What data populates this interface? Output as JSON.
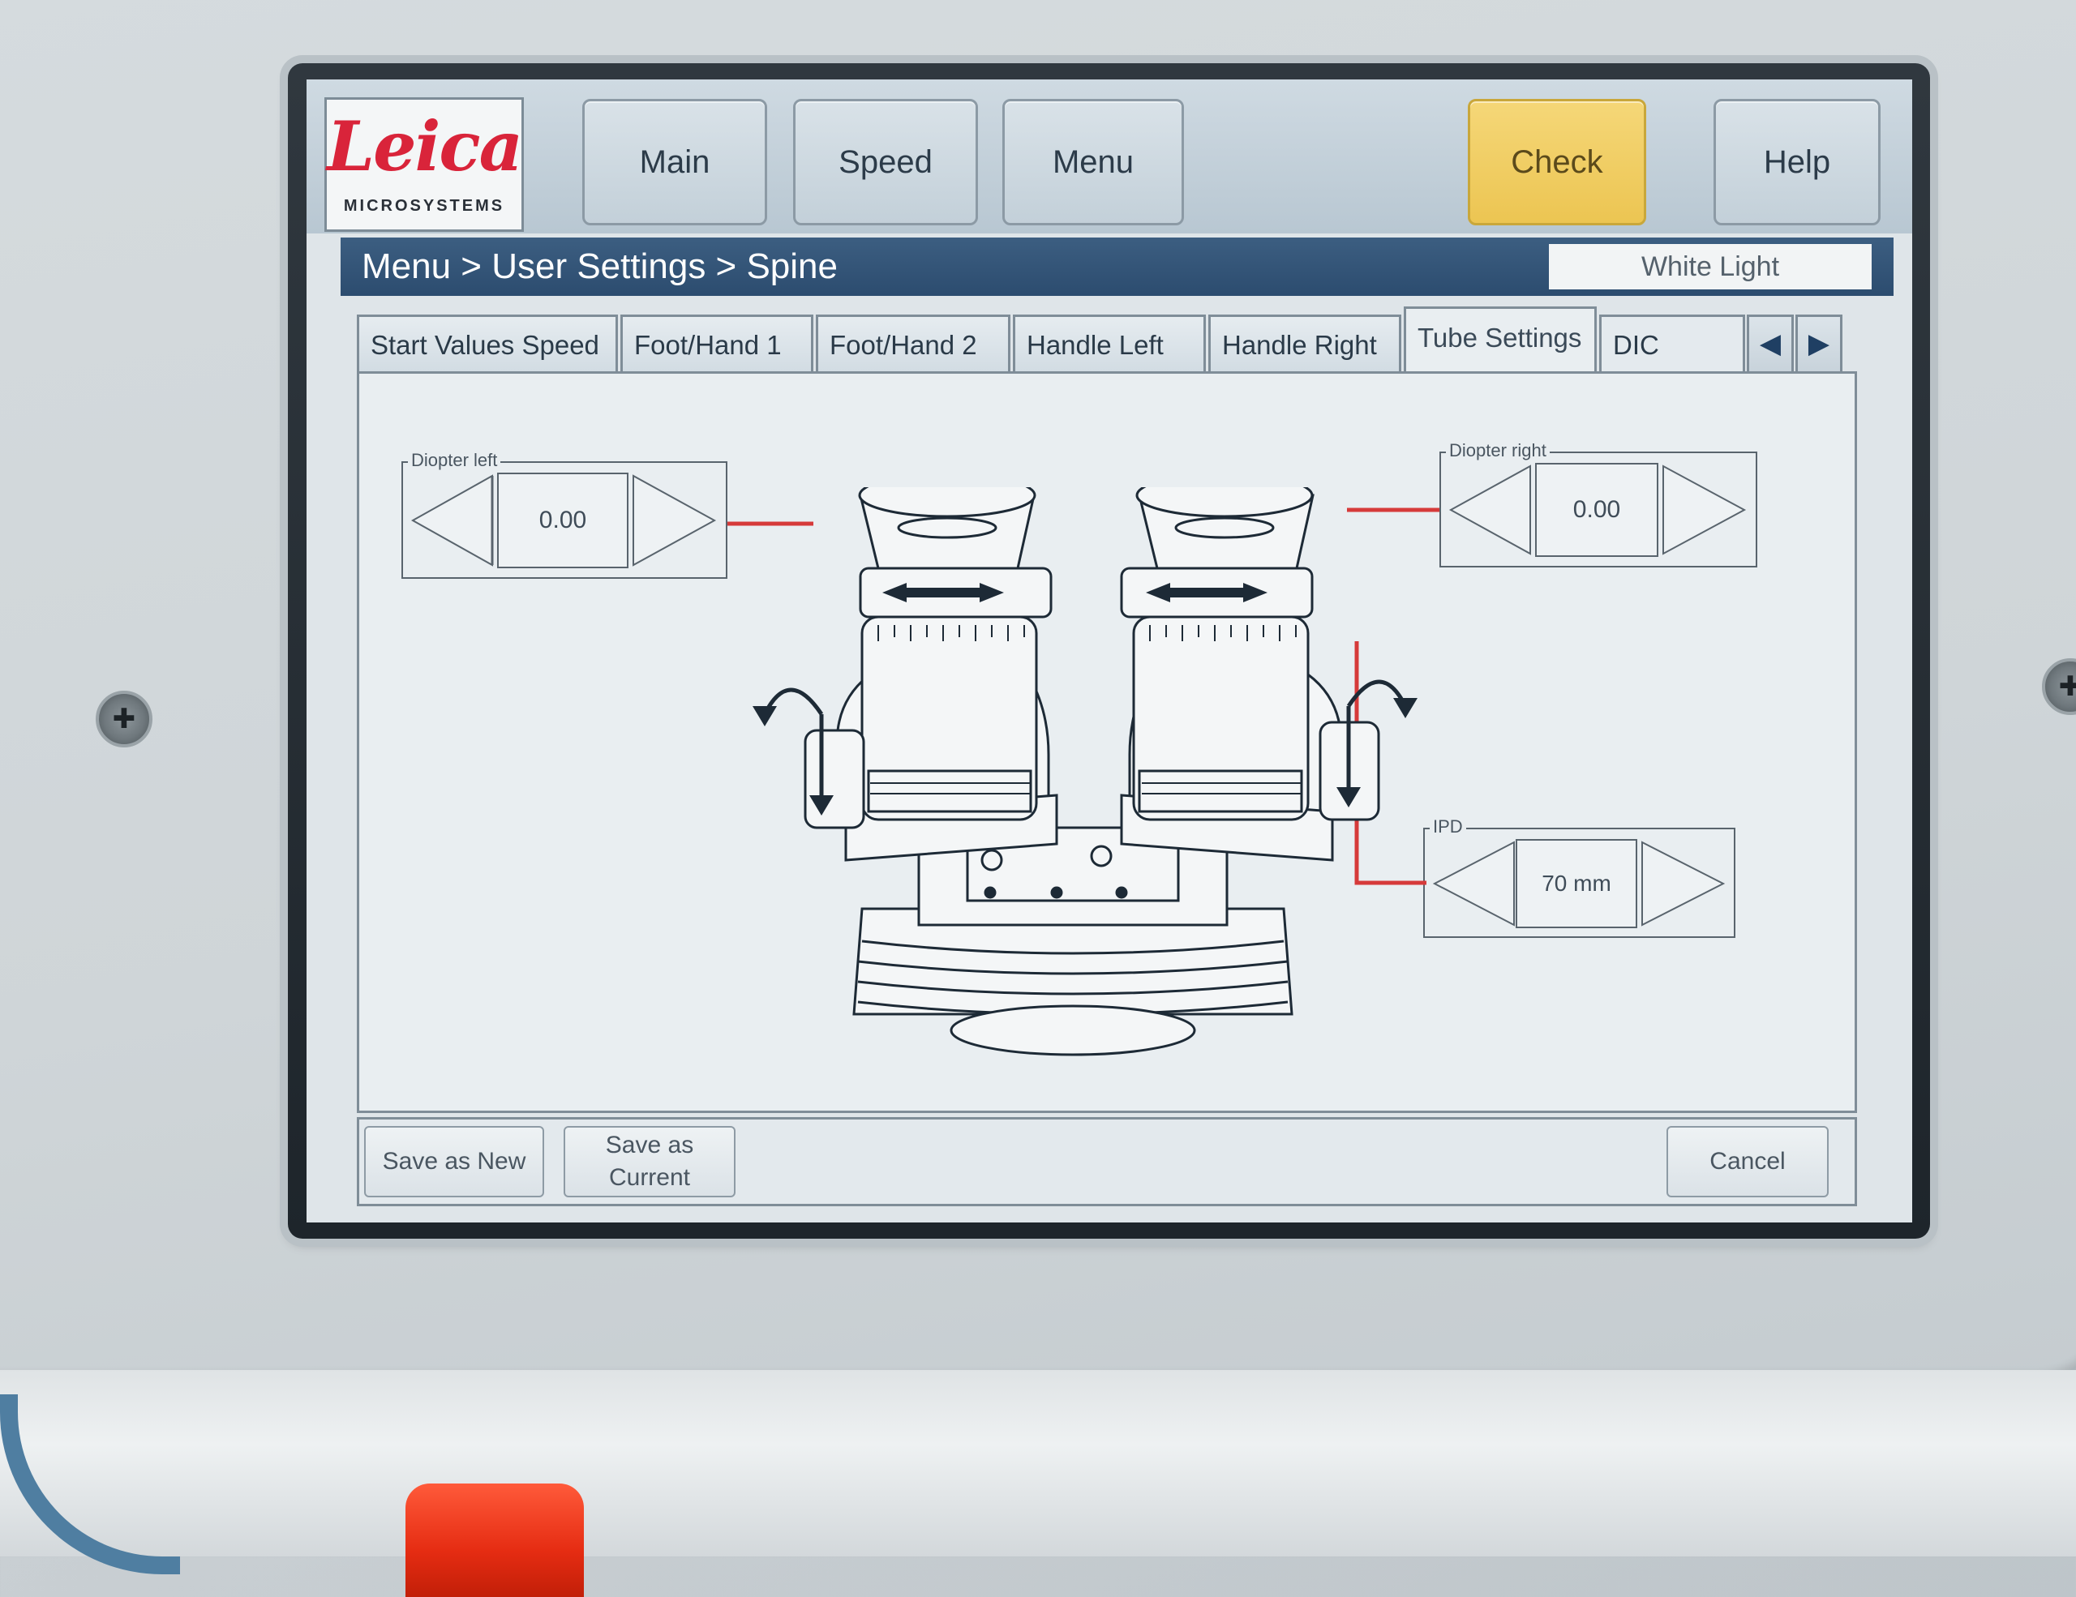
{
  "logo": {
    "brand": "Leica",
    "subtitle": "MICROSYSTEMS"
  },
  "header": {
    "buttons": [
      {
        "label": "Main"
      },
      {
        "label": "Speed"
      },
      {
        "label": "Menu"
      },
      {
        "label": "Check"
      },
      {
        "label": "Help"
      }
    ],
    "check_color": "#ecc552"
  },
  "breadcrumb": "Menu > User Settings > Spine",
  "light_mode": "White Light",
  "tabs": [
    {
      "label": "Start Values Speed"
    },
    {
      "label": "Foot/Hand 1"
    },
    {
      "label": "Foot/Hand 2"
    },
    {
      "label": "Handle Left"
    },
    {
      "label": "Handle Right"
    },
    {
      "label": "Tube Settings",
      "active": true
    },
    {
      "label": "DIC"
    }
  ],
  "settings": {
    "diopter_left": {
      "label": "Diopter left",
      "value": "0.00"
    },
    "diopter_right": {
      "label": "Diopter right",
      "value": "0.00"
    },
    "ipd": {
      "label": "IPD",
      "value": "70 mm"
    }
  },
  "footer": {
    "save_new": "Save as New",
    "save_current_line1": "Save as",
    "save_current_line2": "Current",
    "cancel": "Cancel"
  },
  "accent_colors": {
    "bar": "#2c4c6f",
    "connector": "#d63a3a"
  }
}
